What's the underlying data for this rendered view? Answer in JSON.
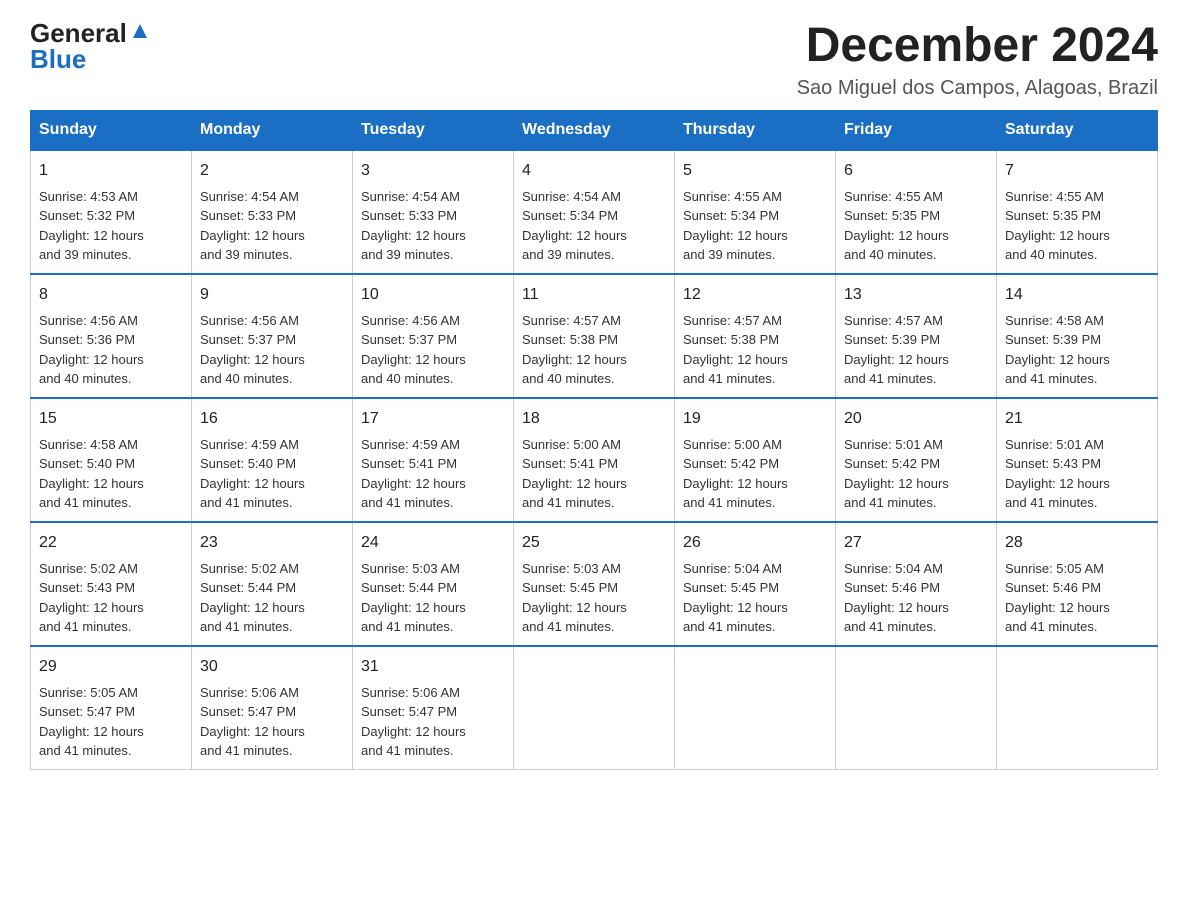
{
  "logo": {
    "general": "General",
    "blue": "Blue"
  },
  "title": "December 2024",
  "location": "Sao Miguel dos Campos, Alagoas, Brazil",
  "days_of_week": [
    "Sunday",
    "Monday",
    "Tuesday",
    "Wednesday",
    "Thursday",
    "Friday",
    "Saturday"
  ],
  "weeks": [
    [
      {
        "day": "1",
        "sunrise": "4:53 AM",
        "sunset": "5:32 PM",
        "daylight": "12 hours and 39 minutes."
      },
      {
        "day": "2",
        "sunrise": "4:54 AM",
        "sunset": "5:33 PM",
        "daylight": "12 hours and 39 minutes."
      },
      {
        "day": "3",
        "sunrise": "4:54 AM",
        "sunset": "5:33 PM",
        "daylight": "12 hours and 39 minutes."
      },
      {
        "day": "4",
        "sunrise": "4:54 AM",
        "sunset": "5:34 PM",
        "daylight": "12 hours and 39 minutes."
      },
      {
        "day": "5",
        "sunrise": "4:55 AM",
        "sunset": "5:34 PM",
        "daylight": "12 hours and 39 minutes."
      },
      {
        "day": "6",
        "sunrise": "4:55 AM",
        "sunset": "5:35 PM",
        "daylight": "12 hours and 40 minutes."
      },
      {
        "day": "7",
        "sunrise": "4:55 AM",
        "sunset": "5:35 PM",
        "daylight": "12 hours and 40 minutes."
      }
    ],
    [
      {
        "day": "8",
        "sunrise": "4:56 AM",
        "sunset": "5:36 PM",
        "daylight": "12 hours and 40 minutes."
      },
      {
        "day": "9",
        "sunrise": "4:56 AM",
        "sunset": "5:37 PM",
        "daylight": "12 hours and 40 minutes."
      },
      {
        "day": "10",
        "sunrise": "4:56 AM",
        "sunset": "5:37 PM",
        "daylight": "12 hours and 40 minutes."
      },
      {
        "day": "11",
        "sunrise": "4:57 AM",
        "sunset": "5:38 PM",
        "daylight": "12 hours and 40 minutes."
      },
      {
        "day": "12",
        "sunrise": "4:57 AM",
        "sunset": "5:38 PM",
        "daylight": "12 hours and 41 minutes."
      },
      {
        "day": "13",
        "sunrise": "4:57 AM",
        "sunset": "5:39 PM",
        "daylight": "12 hours and 41 minutes."
      },
      {
        "day": "14",
        "sunrise": "4:58 AM",
        "sunset": "5:39 PM",
        "daylight": "12 hours and 41 minutes."
      }
    ],
    [
      {
        "day": "15",
        "sunrise": "4:58 AM",
        "sunset": "5:40 PM",
        "daylight": "12 hours and 41 minutes."
      },
      {
        "day": "16",
        "sunrise": "4:59 AM",
        "sunset": "5:40 PM",
        "daylight": "12 hours and 41 minutes."
      },
      {
        "day": "17",
        "sunrise": "4:59 AM",
        "sunset": "5:41 PM",
        "daylight": "12 hours and 41 minutes."
      },
      {
        "day": "18",
        "sunrise": "5:00 AM",
        "sunset": "5:41 PM",
        "daylight": "12 hours and 41 minutes."
      },
      {
        "day": "19",
        "sunrise": "5:00 AM",
        "sunset": "5:42 PM",
        "daylight": "12 hours and 41 minutes."
      },
      {
        "day": "20",
        "sunrise": "5:01 AM",
        "sunset": "5:42 PM",
        "daylight": "12 hours and 41 minutes."
      },
      {
        "day": "21",
        "sunrise": "5:01 AM",
        "sunset": "5:43 PM",
        "daylight": "12 hours and 41 minutes."
      }
    ],
    [
      {
        "day": "22",
        "sunrise": "5:02 AM",
        "sunset": "5:43 PM",
        "daylight": "12 hours and 41 minutes."
      },
      {
        "day": "23",
        "sunrise": "5:02 AM",
        "sunset": "5:44 PM",
        "daylight": "12 hours and 41 minutes."
      },
      {
        "day": "24",
        "sunrise": "5:03 AM",
        "sunset": "5:44 PM",
        "daylight": "12 hours and 41 minutes."
      },
      {
        "day": "25",
        "sunrise": "5:03 AM",
        "sunset": "5:45 PM",
        "daylight": "12 hours and 41 minutes."
      },
      {
        "day": "26",
        "sunrise": "5:04 AM",
        "sunset": "5:45 PM",
        "daylight": "12 hours and 41 minutes."
      },
      {
        "day": "27",
        "sunrise": "5:04 AM",
        "sunset": "5:46 PM",
        "daylight": "12 hours and 41 minutes."
      },
      {
        "day": "28",
        "sunrise": "5:05 AM",
        "sunset": "5:46 PM",
        "daylight": "12 hours and 41 minutes."
      }
    ],
    [
      {
        "day": "29",
        "sunrise": "5:05 AM",
        "sunset": "5:47 PM",
        "daylight": "12 hours and 41 minutes."
      },
      {
        "day": "30",
        "sunrise": "5:06 AM",
        "sunset": "5:47 PM",
        "daylight": "12 hours and 41 minutes."
      },
      {
        "day": "31",
        "sunrise": "5:06 AM",
        "sunset": "5:47 PM",
        "daylight": "12 hours and 41 minutes."
      },
      null,
      null,
      null,
      null
    ]
  ],
  "labels": {
    "sunrise": "Sunrise:",
    "sunset": "Sunset:",
    "daylight": "Daylight:"
  }
}
